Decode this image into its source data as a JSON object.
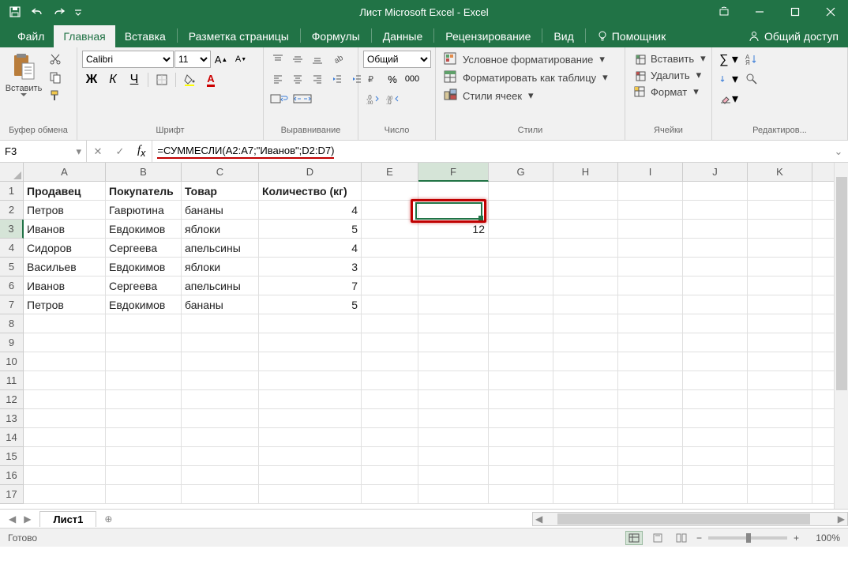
{
  "title": "Лист Microsoft Excel - Excel",
  "tabs": [
    "Файл",
    "Главная",
    "Вставка",
    "Разметка страницы",
    "Формулы",
    "Данные",
    "Рецензирование",
    "Вид",
    "Помощник"
  ],
  "active_tab": 1,
  "share_label": "Общий доступ",
  "ribbon": {
    "clipboard": {
      "label": "Буфер обмена",
      "paste": "Вставить"
    },
    "font": {
      "label": "Шрифт",
      "name": "Calibri",
      "size": "11",
      "b": "Ж",
      "i": "К",
      "u": "Ч"
    },
    "alignment": {
      "label": "Выравнивание"
    },
    "number": {
      "label": "Число",
      "format": "Общий"
    },
    "styles": {
      "label": "Стили",
      "cond_format": "Условное форматирование",
      "as_table": "Форматировать как таблицу",
      "cell_styles": "Стили ячеек"
    },
    "cells": {
      "label": "Ячейки",
      "insert": "Вставить",
      "delete": "Удалить",
      "format": "Формат"
    },
    "editing": {
      "label": "Редактиров..."
    }
  },
  "namebox": "F3",
  "formula": "=СУММЕСЛИ(A2:A7;\"Иванов\";D2:D7)",
  "columns": [
    "A",
    "B",
    "C",
    "D",
    "E",
    "F",
    "G",
    "H",
    "I",
    "J",
    "K",
    ""
  ],
  "rows": [
    "1",
    "2",
    "3",
    "4",
    "5",
    "6",
    "7",
    "8",
    "9",
    "10",
    "11",
    "12",
    "13",
    "14",
    "15",
    "16",
    "17"
  ],
  "headers": [
    "Продавец",
    "Покупатель",
    "Товар",
    "Количество (кг)"
  ],
  "data": [
    [
      "Петров",
      "Гаврютина",
      "бананы",
      "4"
    ],
    [
      "Иванов",
      "Евдокимов",
      "яблоки",
      "5"
    ],
    [
      "Сидоров",
      "Сергеева",
      "апельсины",
      "4"
    ],
    [
      "Васильев",
      "Евдокимов",
      "яблоки",
      "3"
    ],
    [
      "Иванов",
      "Сергеева",
      "апельсины",
      "7"
    ],
    [
      "Петров",
      "Евдокимов",
      "бананы",
      "5"
    ]
  ],
  "selected_cell": {
    "col": "F",
    "row": 3,
    "value": "12"
  },
  "sheet_tab": "Лист1",
  "status": "Готово",
  "zoom": "100%"
}
